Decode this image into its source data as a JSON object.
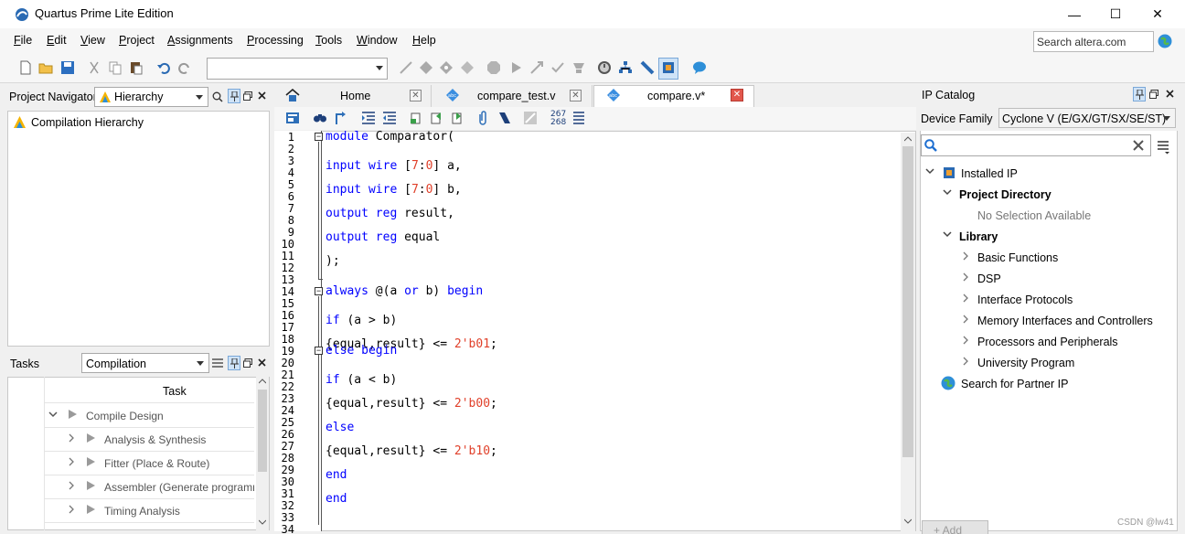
{
  "window": {
    "title": "Quartus Prime Lite Edition",
    "minimize": "—",
    "maximize": "☐",
    "close": "✕"
  },
  "menu": {
    "items": [
      {
        "label": "File",
        "accel": "F",
        "rest": "ile"
      },
      {
        "label": "Edit",
        "accel": "E",
        "rest": "dit"
      },
      {
        "label": "View",
        "accel": "V",
        "rest": "iew"
      },
      {
        "label": "Project",
        "accel": "P",
        "rest": "roject"
      },
      {
        "label": "Assignments",
        "accel": "A",
        "rest": "ssignments"
      },
      {
        "label": "Processing",
        "accel": "P",
        "rest": "rocessing"
      },
      {
        "label": "Tools",
        "accel": "T",
        "rest": "ools"
      },
      {
        "label": "Window",
        "accel": "W",
        "rest": "indow"
      },
      {
        "label": "Help",
        "accel": "H",
        "rest": "elp"
      }
    ],
    "search_placeholder": "Search altera.com"
  },
  "toolbar": {
    "revision_combo_value": ""
  },
  "project_navigator": {
    "title": "Project Navigator",
    "view_selected": "Hierarchy",
    "tree_item": "Compilation Hierarchy"
  },
  "tasks": {
    "title": "Tasks",
    "flow_selected": "Compilation",
    "column_header": "Task",
    "rows": [
      {
        "label": "Compile Design",
        "level": 0
      },
      {
        "label": "Analysis & Synthesis",
        "level": 1
      },
      {
        "label": "Fitter (Place & Route)",
        "level": 1
      },
      {
        "label": "Assembler (Generate programm",
        "level": 1
      },
      {
        "label": "Timing Analysis",
        "level": 1
      }
    ]
  },
  "editor": {
    "tabs": [
      {
        "label": "Home",
        "active": false
      },
      {
        "label": "compare_test.v",
        "active": false
      },
      {
        "label": "compare.v*",
        "active": true
      }
    ],
    "line_numbers": [
      "1",
      "2",
      "3",
      "4",
      "5",
      "6",
      "7",
      "8",
      "9",
      "10",
      "11",
      "12",
      "13",
      "14",
      "15",
      "16",
      "17",
      "18",
      "19",
      "20",
      "21",
      "22",
      "23",
      "24",
      "25",
      "26",
      "27",
      "28",
      "29",
      "30",
      "31",
      "32",
      "33",
      "34"
    ],
    "position_top": "267",
    "position_bottom": "268",
    "code": [
      {
        "parts": [
          [
            "kw",
            "module"
          ],
          [
            "",
            "Comparator("
          ]
        ]
      },
      {
        "parts": [
          [
            "kw",
            "input"
          ],
          [
            "",
            ""
          ],
          [
            "kw",
            "wire"
          ],
          [
            "",
            ""
          ],
          [
            "",
            "["
          ],
          [
            "num",
            "7"
          ],
          [
            "",
            ":"
          ],
          [
            "num",
            "0"
          ],
          [
            "",
            "] a,"
          ]
        ]
      },
      {
        "parts": [
          [
            "kw",
            "input"
          ],
          [
            "",
            ""
          ],
          [
            "kw",
            "wire"
          ],
          [
            "",
            ""
          ],
          [
            "",
            "["
          ],
          [
            "num",
            "7"
          ],
          [
            "",
            ":"
          ],
          [
            "num",
            "0"
          ],
          [
            "",
            "] b,"
          ]
        ]
      },
      {
        "parts": [
          [
            "kw",
            "output"
          ],
          [
            "",
            ""
          ],
          [
            "kw",
            "reg"
          ],
          [
            "",
            "result,"
          ]
        ]
      },
      {
        "parts": [
          [
            "kw",
            "output"
          ],
          [
            "",
            ""
          ],
          [
            "kw",
            "reg"
          ],
          [
            "",
            "equal"
          ]
        ]
      },
      {
        "parts": [
          [
            "",
            ");"
          ]
        ]
      },
      {
        "parts": [
          [
            "kw",
            "always"
          ],
          [
            "",
            "@(a "
          ],
          [
            "kw",
            "or"
          ],
          [
            "",
            "b) "
          ],
          [
            "kw",
            "begin"
          ]
        ]
      },
      {
        "parts": [
          [
            "kw",
            "if"
          ],
          [
            "",
            "(a > b)"
          ]
        ]
      },
      {
        "parts": [
          [
            "",
            "{equal,result} <= "
          ],
          [
            "num",
            "2'b01"
          ],
          [
            "",
            ";"
          ]
        ]
      },
      {
        "parts": [
          [
            "kw",
            "else"
          ],
          [
            "",
            ""
          ],
          [
            "kw",
            "begin"
          ]
        ]
      },
      {
        "parts": [
          [
            "kw",
            "if"
          ],
          [
            "",
            "(a < b)"
          ]
        ]
      },
      {
        "parts": [
          [
            "",
            "{equal,result} <= "
          ],
          [
            "num",
            "2'b00"
          ],
          [
            "",
            ";"
          ]
        ]
      },
      {
        "parts": [
          [
            "kw",
            "else"
          ]
        ]
      },
      {
        "parts": [
          [
            "",
            "{equal,result} <= "
          ],
          [
            "num",
            "2'b10"
          ],
          [
            "",
            ";"
          ]
        ]
      },
      {
        "parts": [
          [
            "kw",
            "end"
          ]
        ]
      },
      {
        "parts": [
          [
            "kw",
            "end"
          ]
        ]
      }
    ]
  },
  "ip_catalog": {
    "title": "IP Catalog",
    "family_label": "Device Family",
    "family_value": "Cyclone V (E/GX/GT/SX/SE/ST)",
    "search_value": "",
    "installed_ip": "Installed IP",
    "project_directory": "Project Directory",
    "no_selection": "No Selection Available",
    "library": "Library",
    "library_items": [
      "Basic Functions",
      "DSP",
      "Interface Protocols",
      "Memory Interfaces and Controllers",
      "Processors and Peripherals",
      "University Program"
    ],
    "partner": "Search for Partner IP",
    "add_button": "+ Add"
  },
  "watermark": "CSDN @lw41",
  "colors": {
    "keyword": "#0000ff",
    "number": "#e0402a",
    "close_red": "#d9534f",
    "accent_blue": "#1e6fd1"
  }
}
